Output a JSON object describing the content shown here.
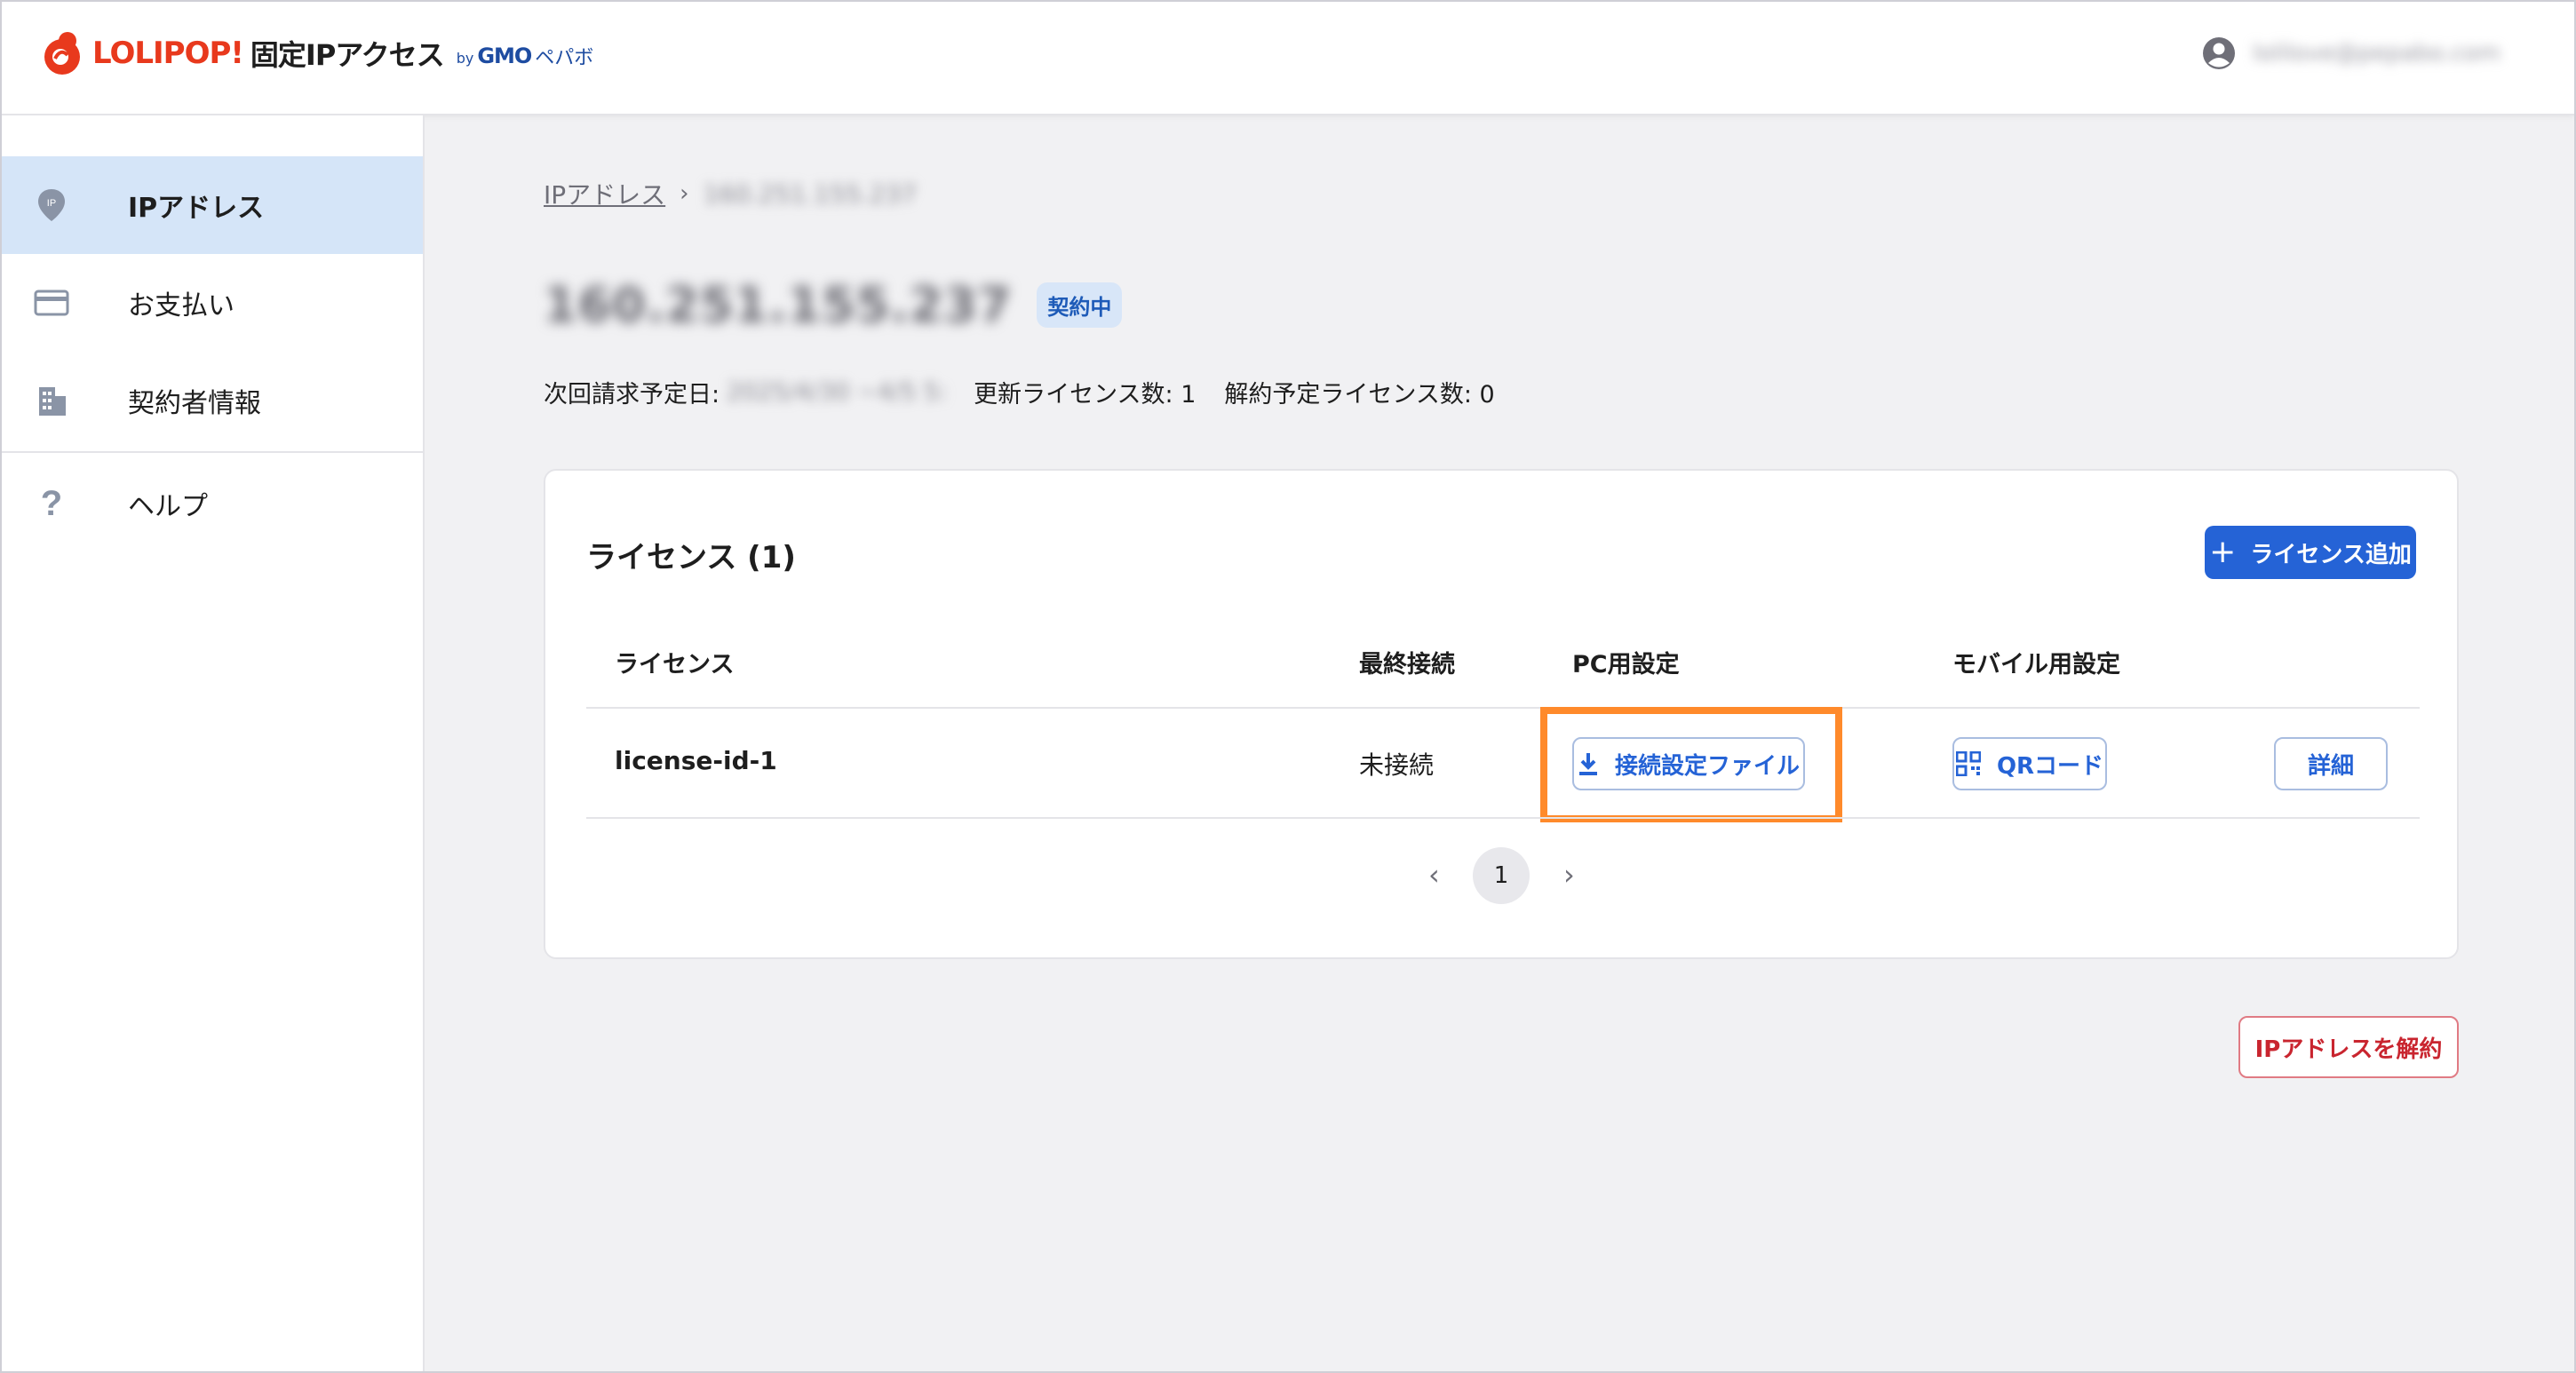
{
  "header": {
    "logo": {
      "brand": "LOLIPOP!",
      "product": "固定IPアクセス",
      "by": "by",
      "company": "GMO",
      "company_sub": "ペパボ"
    },
    "account_email": "lolilove@pepabo.com"
  },
  "sidebar": {
    "items": [
      {
        "label": "IPアドレス",
        "icon": "ip-pin-icon",
        "active": true
      },
      {
        "label": "お支払い",
        "icon": "credit-card-icon",
        "active": false
      },
      {
        "label": "契約者情報",
        "icon": "building-icon",
        "active": false
      },
      {
        "label": "ヘルプ",
        "icon": "question-icon",
        "active": false
      }
    ]
  },
  "breadcrumb": {
    "root": "IPアドレス",
    "separator": "›",
    "current": "160.251.155.237"
  },
  "ip": {
    "address": "160.251.155.237",
    "status": "契約中"
  },
  "meta": {
    "next_billing_label": "次回請求予定日:",
    "next_billing_value": "2025/4/30 ~4/5 5:",
    "renew_label": "更新ライセンス数: 1",
    "cancel_label": "解約予定ライセンス数: 0"
  },
  "licenses": {
    "title": "ライセンス (1)",
    "add_button": "ライセンス追加",
    "columns": [
      "ライセンス",
      "最終接続",
      "PC用設定",
      "モバイル用設定"
    ],
    "rows": [
      {
        "id": "license-id-1",
        "last_connection": "未接続",
        "pc_button": "接続設定ファイル",
        "mobile_button": "QRコード",
        "detail_button": "詳細"
      }
    ],
    "pagination": {
      "prev": "‹",
      "current": "1",
      "next": "›"
    }
  },
  "cancel_ip_button": "IPアドレスを解約",
  "colors": {
    "primary": "#2563d6",
    "active_nav": "#d5e5f8",
    "danger": "#c9252f",
    "highlight": "#ff8a2b",
    "brand": "#e8391d"
  }
}
